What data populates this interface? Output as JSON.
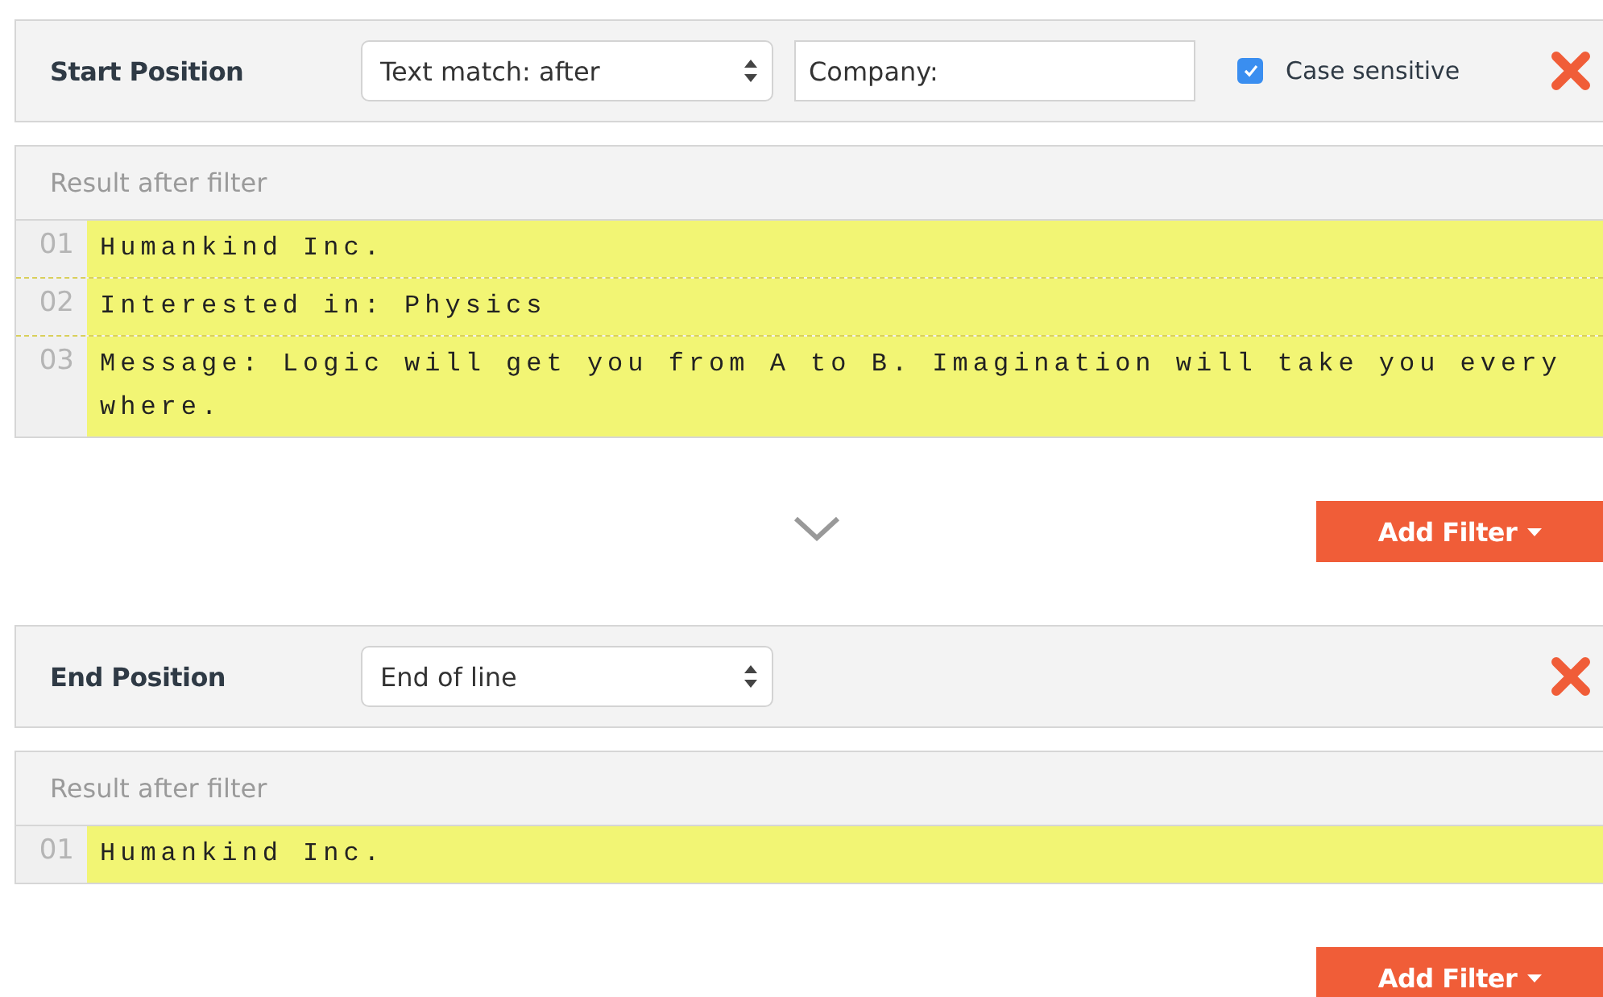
{
  "filters": [
    {
      "label": "Start Position",
      "mode": "Text match: after",
      "match_text": "Company:",
      "case_sensitive": {
        "label": "Case sensitive",
        "checked": true
      },
      "result": {
        "title": "Result after filter",
        "lines": [
          {
            "number": "01",
            "text": "Humankind Inc."
          },
          {
            "number": "02",
            "text": "Interested in: Physics"
          },
          {
            "number": "03",
            "text": "Message: Logic will get you from A to B. Imagination will take you everywhere."
          }
        ]
      },
      "add_filter": "Add Filter"
    },
    {
      "label": "End Position",
      "mode": "End of line",
      "result": {
        "title": "Result after filter",
        "lines": [
          {
            "number": "01",
            "text": "Humankind Inc."
          }
        ]
      },
      "add_filter": "Add Filter"
    }
  ]
}
